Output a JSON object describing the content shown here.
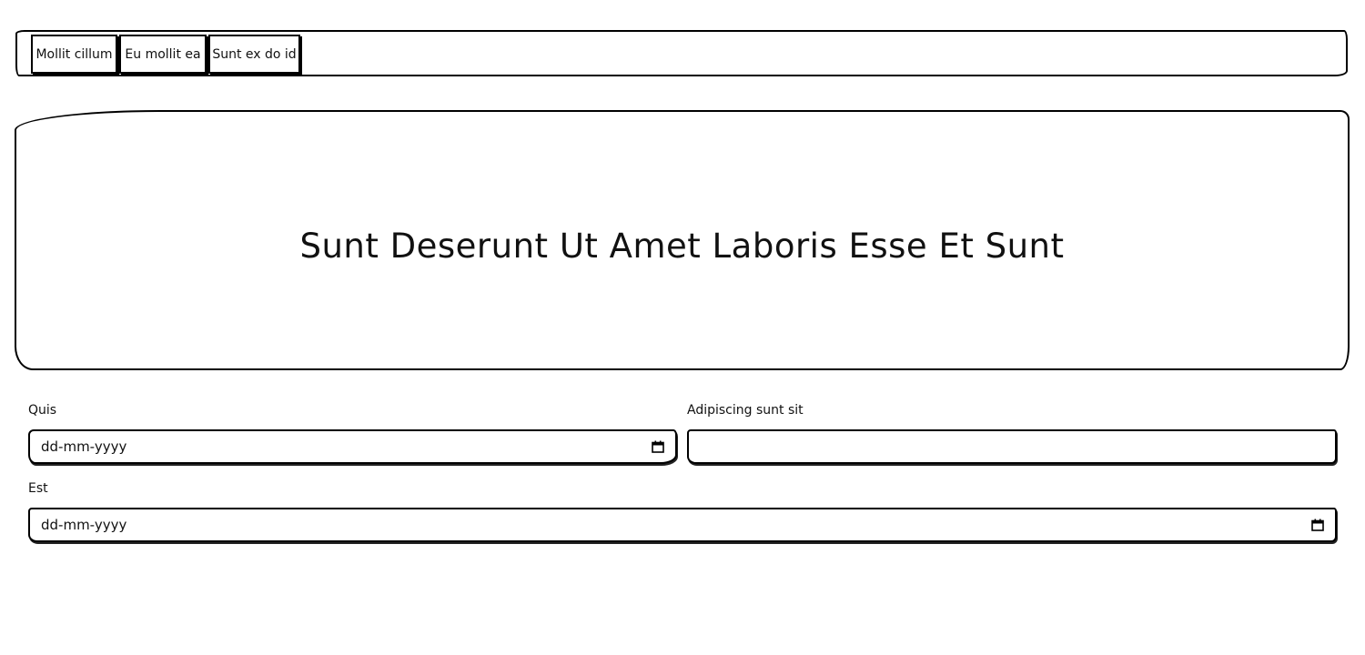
{
  "nav": {
    "items": [
      {
        "label": "Mollit cillum"
      },
      {
        "label": "Eu mollit ea"
      },
      {
        "label": "Sunt ex do id"
      }
    ]
  },
  "hero": {
    "title": "Sunt Deserunt Ut Amet Laboris Esse Et Sunt"
  },
  "form": {
    "quis": {
      "label": "Quis",
      "placeholder": "dd-mm-yyyy",
      "icon": "calendar-icon"
    },
    "adipiscing": {
      "label": "Adipiscing sunt sit",
      "value": ""
    },
    "est": {
      "label": "Est",
      "placeholder": "dd-mm-yyyy",
      "icon": "calendar-icon"
    }
  }
}
